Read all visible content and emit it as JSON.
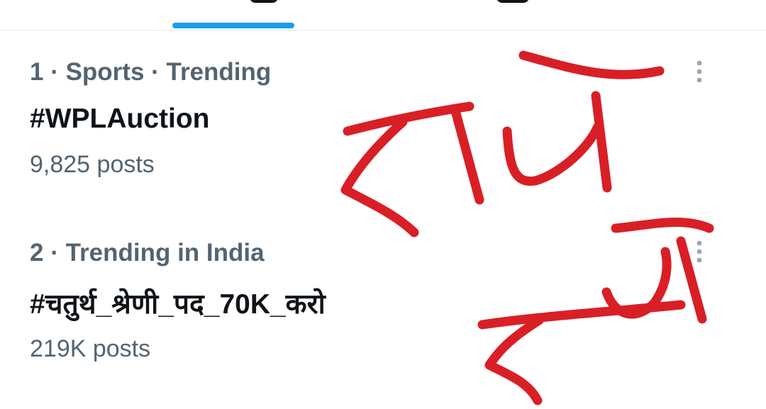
{
  "tabs": {
    "active_indicator_color": "#1d9bf0"
  },
  "trends": [
    {
      "meta": "1 · Sports · Trending",
      "name": "#WPLAuction",
      "posts": "9,825 posts",
      "more_icon": "more-vertical-icon"
    },
    {
      "meta": "2 · Trending in India",
      "name": "#चतुर्थ_श्रेणी_पद_70K_करो",
      "posts": "219K posts",
      "more_icon": "more-vertical-icon"
    }
  ],
  "annotation": {
    "text": "राधे राधे",
    "color": "#d91f26"
  }
}
